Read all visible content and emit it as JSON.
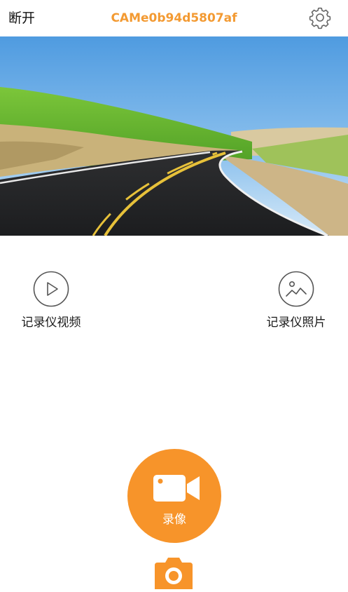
{
  "header": {
    "disconnect_label": "断开",
    "device_name": "CAMe0b94d5807af",
    "settings_icon": "gear-icon"
  },
  "preview": {
    "image": "road-landscape-live-preview"
  },
  "entries": {
    "video": {
      "label": "记录仪视频",
      "icon": "play-circle-icon"
    },
    "photo": {
      "label": "记录仪照片",
      "icon": "image-circle-icon"
    }
  },
  "record": {
    "label": "录像",
    "icon": "video-camera-icon"
  },
  "snapshot": {
    "icon": "photo-camera-icon"
  },
  "colors": {
    "accent": "#f7942a",
    "title": "#f39a32",
    "icon_gray": "#555555"
  }
}
